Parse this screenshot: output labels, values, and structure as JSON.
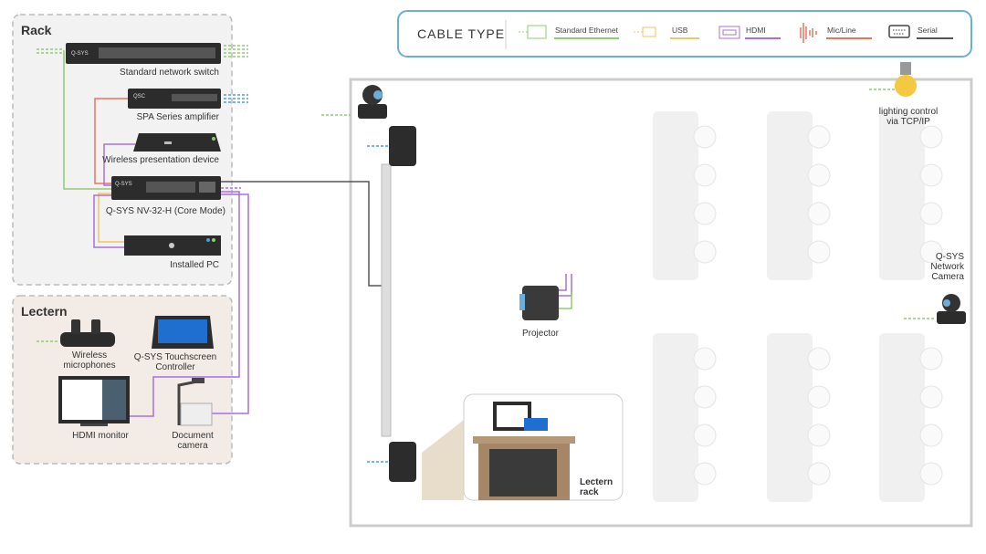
{
  "legend": {
    "title": "CABLE TYPE",
    "items": [
      {
        "label": "Standard Ethernet",
        "icon": "ethernet-icon",
        "color": "#8fcc6f"
      },
      {
        "label": "USB",
        "icon": "usb-icon",
        "color": "#efc66a"
      },
      {
        "label": "HDMI",
        "icon": "hdmi-icon",
        "color": "#a86ee0"
      },
      {
        "label": "Mic/Line",
        "icon": "audio-wave-icon",
        "color": "#e8735f"
      },
      {
        "label": "Serial",
        "icon": "serial-port-icon",
        "color": "#555555"
      }
    ]
  },
  "rack": {
    "title": "Rack",
    "devices": {
      "switch": "Standard network switch",
      "amp": "SPA Series amplifier",
      "wireless": "Wireless presentation device",
      "core": "Q-SYS NV-32-H (Core Mode)",
      "pc": "Installed PC"
    },
    "logo_qsys": "Q-SYS",
    "logo_qsc": "QSC"
  },
  "lectern": {
    "title": "Lectern",
    "devices": {
      "mics": "Wireless\nmicrophones",
      "touch": "Q-SYS Touchscreen\nController",
      "monitor": "HDMI monitor",
      "doccam": "Document\ncamera"
    }
  },
  "room": {
    "projector": "Projector",
    "lighting": "lighting control\nvia TCP/IP",
    "camera": "Q-SYS\nNetwork\nCamera",
    "lectern_rack": "Lectern\nrack"
  }
}
